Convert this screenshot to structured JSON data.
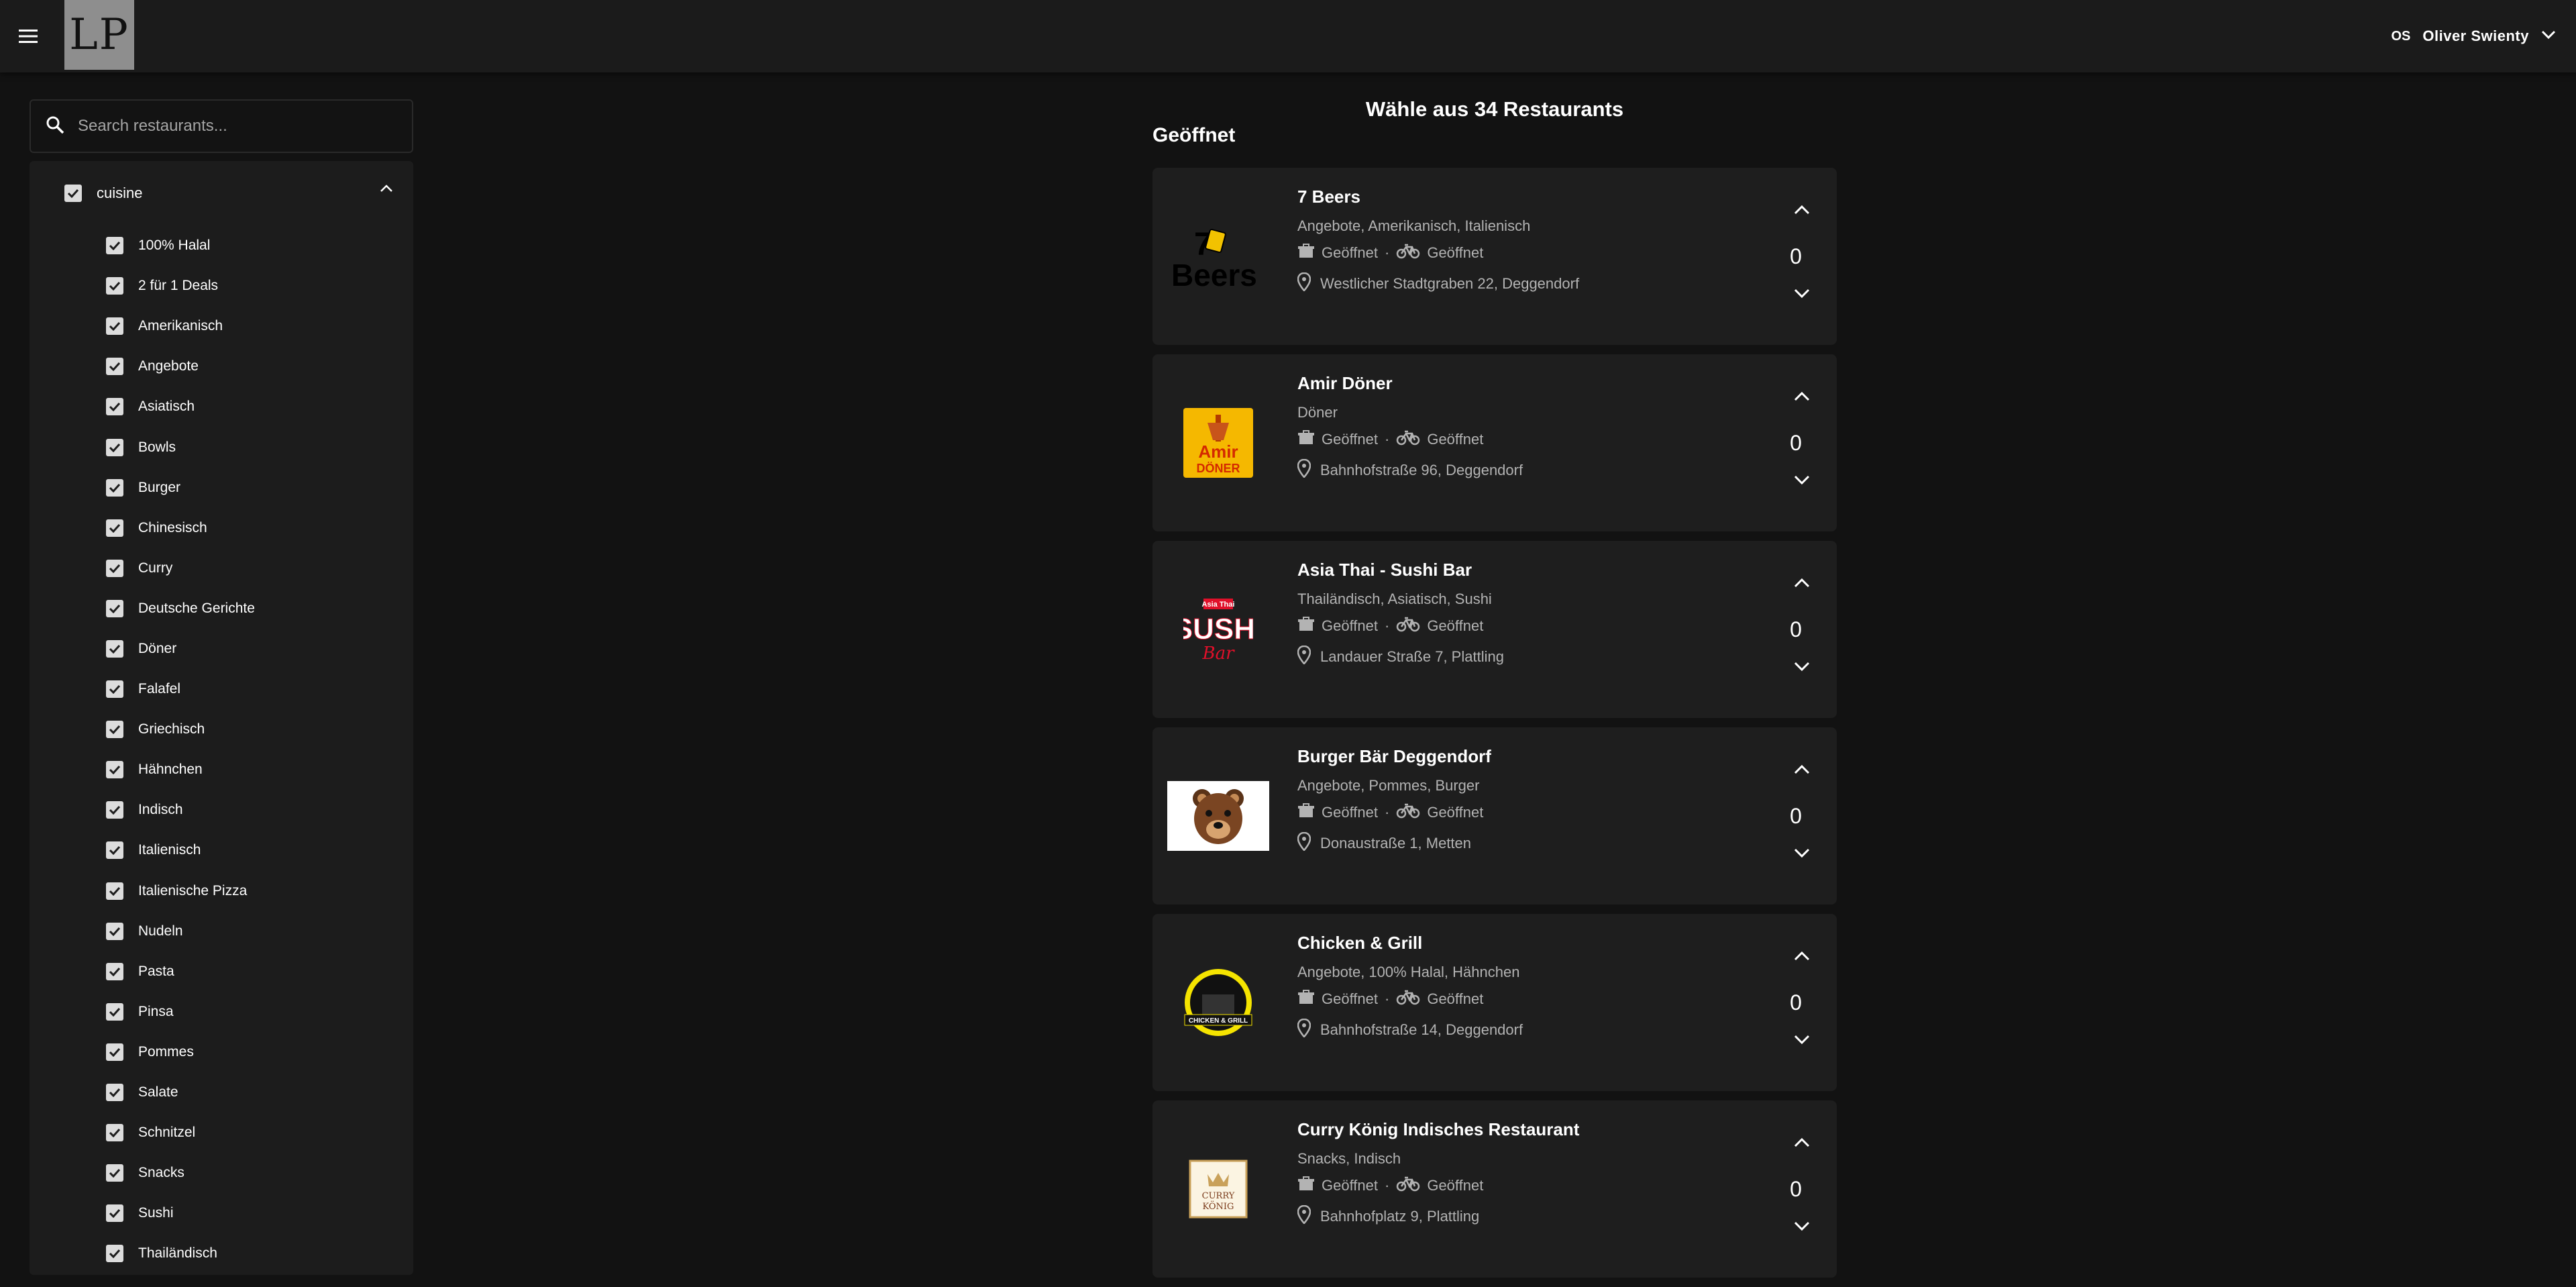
{
  "header": {
    "logo_text": "LP",
    "user_initials": "OS",
    "user_name": "Oliver Swienty"
  },
  "sidebar": {
    "search_placeholder": "Search restaurants...",
    "category_label": "cuisine",
    "items": [
      "100% Halal",
      "2 für 1 Deals",
      "Amerikanisch",
      "Angebote",
      "Asiatisch",
      "Bowls",
      "Burger",
      "Chinesisch",
      "Curry",
      "Deutsche Gerichte",
      "Döner",
      "Falafel",
      "Griechisch",
      "Hähnchen",
      "Indisch",
      "Italienisch",
      "Italienische Pizza",
      "Nudeln",
      "Pasta",
      "Pinsa",
      "Pommes",
      "Salate",
      "Schnitzel",
      "Snacks",
      "Sushi",
      "Thailändisch"
    ]
  },
  "main": {
    "title": "Wähle aus 34 Restaurants",
    "section_label": "Geöffnet",
    "status_separator": "·",
    "restaurants": [
      {
        "name": "7 Beers",
        "cuisines": "Angebote, Amerikanisch, Italienisch",
        "pickup_status": "Geöffnet",
        "delivery_status": "Geöffnet",
        "address": "Westlicher Stadtgraben 22, Deggendorf",
        "quantity": "0",
        "logo": "7beers"
      },
      {
        "name": "Amir Döner",
        "cuisines": "Döner",
        "pickup_status": "Geöffnet",
        "delivery_status": "Geöffnet",
        "address": "Bahnhofstraße 96, Deggendorf",
        "quantity": "0",
        "logo": "amir"
      },
      {
        "name": "Asia Thai - Sushi Bar",
        "cuisines": "Thailändisch, Asiatisch, Sushi",
        "pickup_status": "Geöffnet",
        "delivery_status": "Geöffnet",
        "address": "Landauer Straße 7, Plattling",
        "quantity": "0",
        "logo": "sushi"
      },
      {
        "name": "Burger Bär Deggendorf",
        "cuisines": "Angebote, Pommes, Burger",
        "pickup_status": "Geöffnet",
        "delivery_status": "Geöffnet",
        "address": "Donaustraße 1, Metten",
        "quantity": "0",
        "logo": "bear"
      },
      {
        "name": "Chicken & Grill",
        "cuisines": "Angebote, 100% Halal, Hähnchen",
        "pickup_status": "Geöffnet",
        "delivery_status": "Geöffnet",
        "address": "Bahnhofstraße 14, Deggendorf",
        "quantity": "0",
        "logo": "chicken"
      },
      {
        "name": "Curry König Indisches Restaurant",
        "cuisines": "Snacks, Indisch",
        "pickup_status": "Geöffnet",
        "delivery_status": "Geöffnet",
        "address": "Bahnhofplatz 9, Plattling",
        "quantity": "0",
        "logo": "curry"
      }
    ],
    "logo_texts": {
      "beers_num": "7",
      "beers_word": "Beers",
      "amir_top": "Amir",
      "amir_bottom": "DÖNER",
      "sushi_tag": "Asia Thai",
      "sushi_main": "SUSHI",
      "sushi_script": "Bar",
      "chicken_band": "CHICKEN & GRILL",
      "curry_top": "CURRY",
      "curry_bottom": "KÖNIG"
    }
  },
  "colors": {
    "background": "#121212",
    "appbar": "#1b1b1b",
    "card": "#1e1e1e",
    "muted_text": "#b3b3b3"
  }
}
